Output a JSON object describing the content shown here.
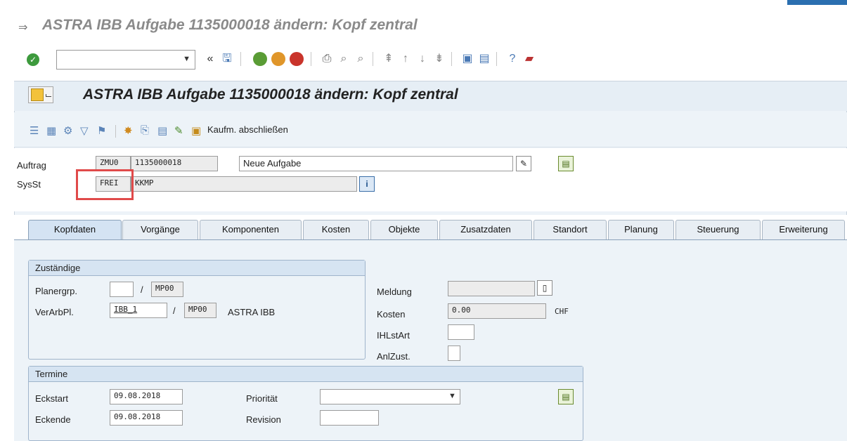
{
  "window": {
    "title": "ASTRA IBB Aufgabe 1135000018 ändern: Kopf zentral"
  },
  "panel": {
    "title": "ASTRA IBB Aufgabe 1135000018 ändern: Kopf zentral"
  },
  "appbar": {
    "close_label": "Kaufm. abschließen"
  },
  "header": {
    "auftrag_label": "Auftrag",
    "auftrag_type": "ZMU0",
    "auftrag_number": "1135000018",
    "auftrag_text": "Neue Aufgabe",
    "sysst_label": "SysSt",
    "sysst_value": "FREI",
    "sysst_extra": "KKMP"
  },
  "tabs": [
    {
      "label": "Kopfdaten",
      "active": true
    },
    {
      "label": "Vorgänge"
    },
    {
      "label": "Komponenten"
    },
    {
      "label": "Kosten"
    },
    {
      "label": "Objekte"
    },
    {
      "label": "Zusatzdaten"
    },
    {
      "label": "Standort"
    },
    {
      "label": "Planung"
    },
    {
      "label": "Steuerung"
    },
    {
      "label": "Erweiterung"
    }
  ],
  "zustaendige": {
    "title": "Zuständige",
    "planergrp_label": "Planergrp.",
    "planergrp_value": "",
    "planergrp_werk": "MP00",
    "verarbpl_label": "VerArbPl.",
    "verarbpl_value": "IBB_1",
    "verarbpl_werk": "MP00",
    "verarbpl_desc": "ASTRA IBB",
    "slash": "/"
  },
  "right_fields": {
    "meldung_label": "Meldung",
    "meldung_value": "",
    "kosten_label": "Kosten",
    "kosten_value": "0.00",
    "kosten_currency": "CHF",
    "ihlstart_label": "IHLstArt",
    "ihlstart_value": "",
    "anlzust_label": "AnlZust.",
    "anlzust_value": ""
  },
  "termine": {
    "title": "Termine",
    "eckstart_label": "Eckstart",
    "eckstart_value": "09.08.2018",
    "eckende_label": "Eckende",
    "eckende_value": "09.08.2018",
    "prioritaet_label": "Priorität",
    "prioritaet_value": "",
    "revision_label": "Revision",
    "revision_value": ""
  }
}
